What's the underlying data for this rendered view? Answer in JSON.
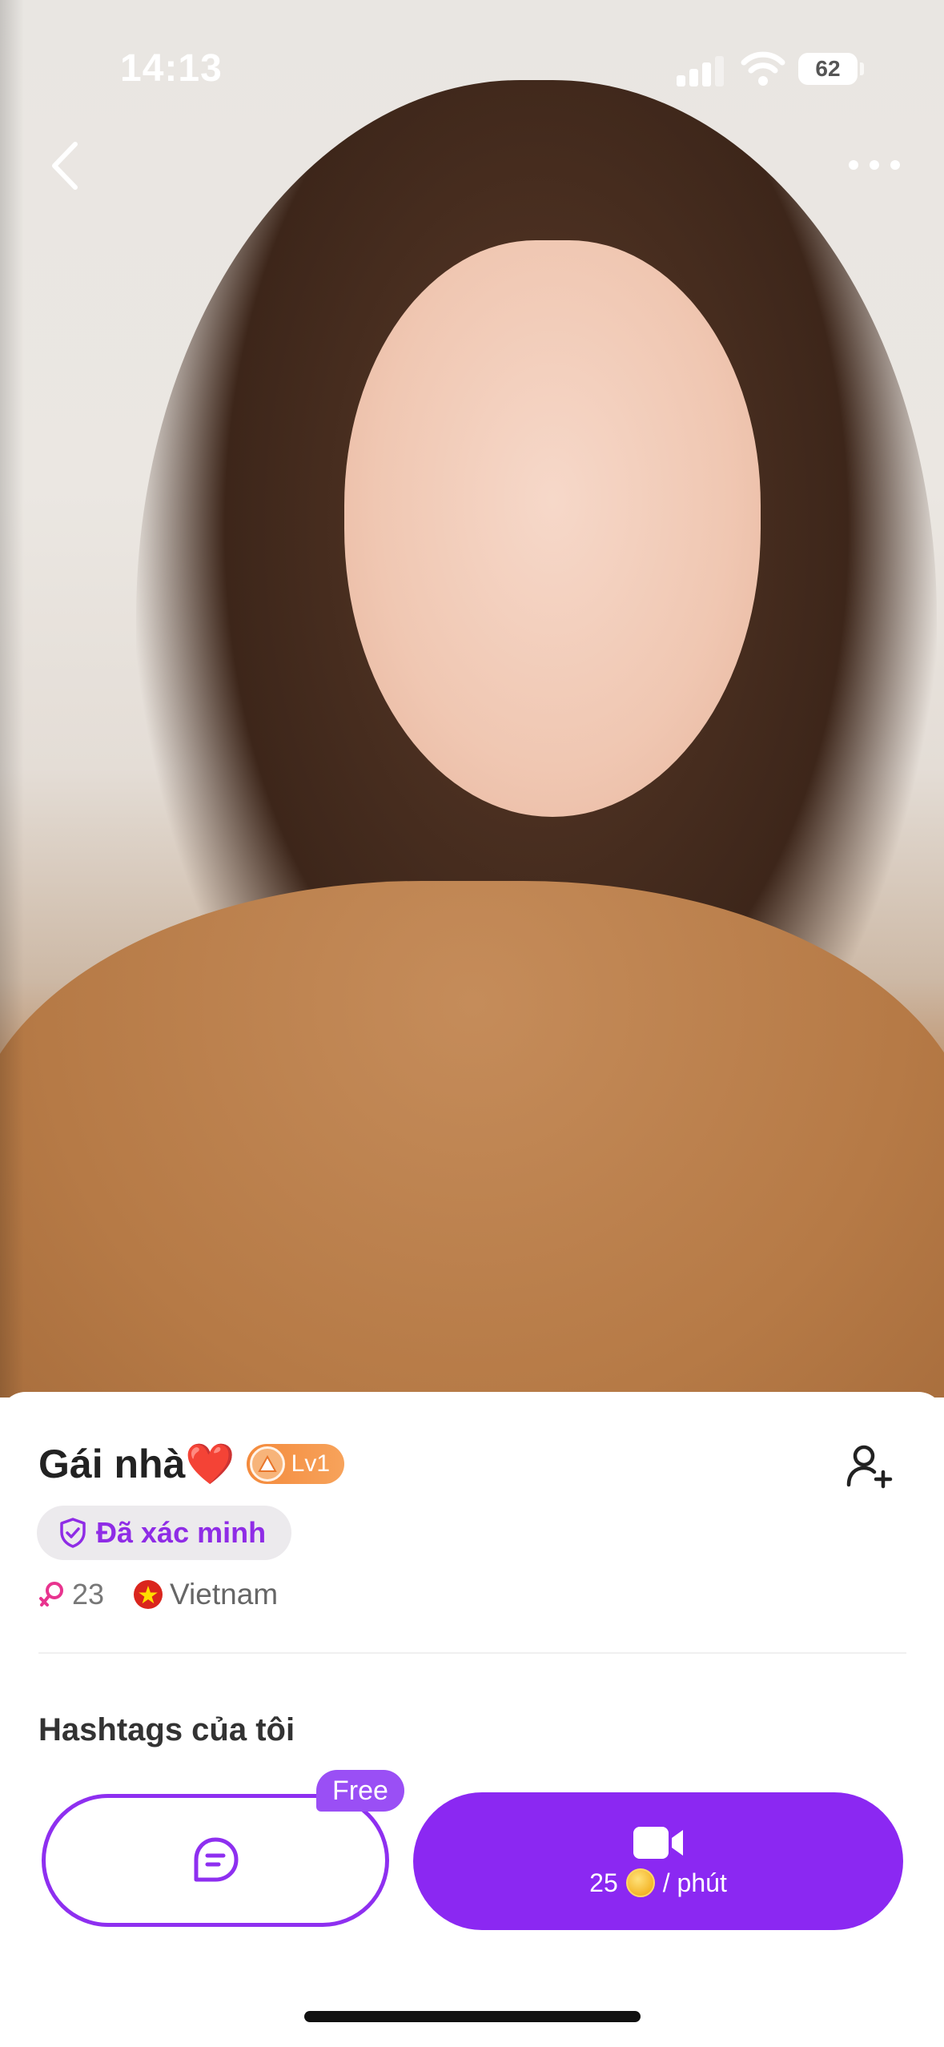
{
  "status_bar": {
    "time": "14:13",
    "battery": "62"
  },
  "profile": {
    "name": "Gái nhà❤️",
    "level": "Lv1",
    "verified_label": "Đã xác minh",
    "age": "23",
    "country": "Vietnam"
  },
  "sections": {
    "hashtags_title": "Hashtags của tôi"
  },
  "actions": {
    "chat_free_badge": "Free",
    "call_price": "25",
    "call_unit": "/ phút"
  },
  "colors": {
    "accent": "#8b28f2",
    "verified_text": "#8f2ce6",
    "level_badge": "#f48a3c",
    "gender_pink": "#e8348f"
  },
  "icons": [
    "back-icon",
    "more-icon",
    "level-icon",
    "add-friend-icon",
    "shield-check-icon",
    "female-icon",
    "vietnam-flag-icon",
    "chat-icon",
    "video-camera-icon",
    "coin-icon"
  ]
}
